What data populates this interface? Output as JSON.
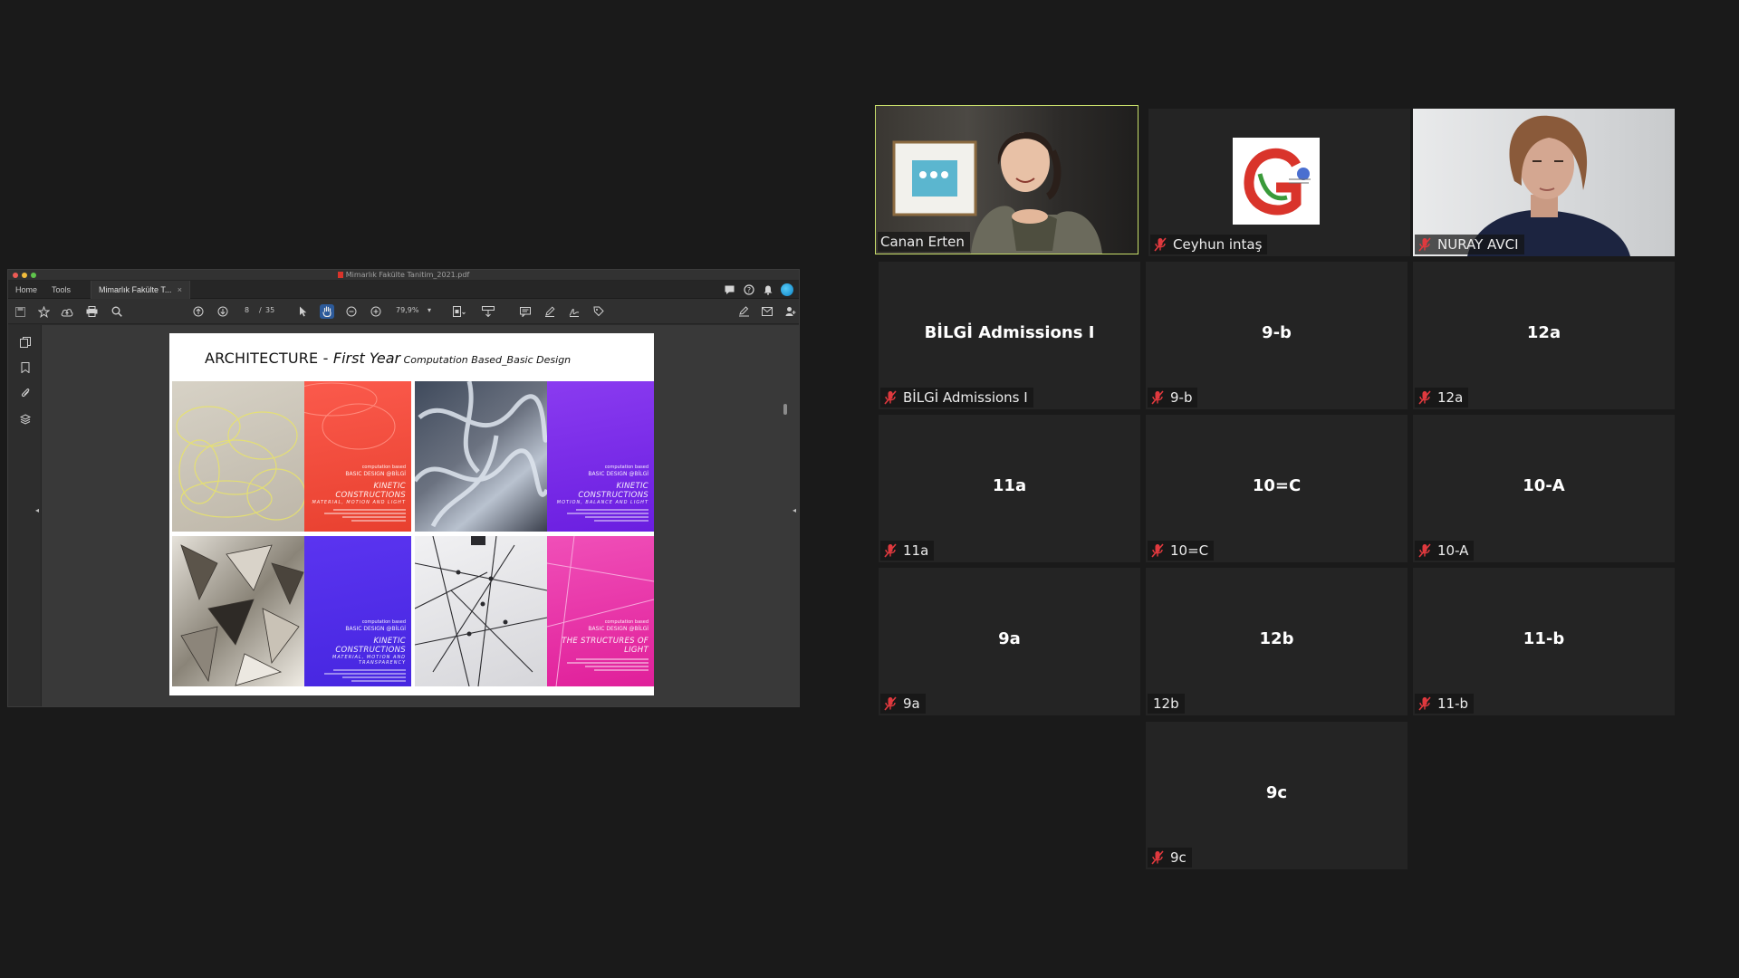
{
  "share": {
    "window_title": "Mimarlık Fakülte Tanitim_2021.pdf",
    "tabs": [
      {
        "label": "Home"
      },
      {
        "label": "Tools"
      },
      {
        "label": "Mimarlık Fakülte T..."
      }
    ],
    "tab_close": "×",
    "page_current": "8",
    "page_separator": "/",
    "page_total": "35",
    "zoom": "79,9%",
    "slide": {
      "title_part1": "ARCHITECTURE",
      "title_dash": " - ",
      "title_part2": "First Year",
      "title_part3": " Computation Based_Basic Design",
      "posters": [
        {
          "top_small": "computation based",
          "heading": "BASIC DESIGN @BİLGİ",
          "title": "KINETIC CONSTRUCTIONS",
          "subtitle": "MATERIAL, MOTION AND LIGHT"
        },
        {
          "top_small": "computation based",
          "heading": "BASIC DESIGN @BİLGİ",
          "title": "KINETIC CONSTRUCTIONS",
          "subtitle": "MOTION, BALANCE AND LIGHT"
        },
        {
          "top_small": "computation based",
          "heading": "BASIC DESIGN @BİLGİ",
          "title": "KINETIC CONSTRUCTIONS",
          "subtitle": "MATERIAL, MOTION AND TRANSPARENCY"
        },
        {
          "top_small": "computation based",
          "heading": "BASIC DESIGN @BİLGİ",
          "title": "THE STRUCTURES OF LIGHT",
          "subtitle": ""
        }
      ]
    }
  },
  "participants": [
    {
      "name": "Canan Erten",
      "kind": "video",
      "muted": false,
      "speaking": true
    },
    {
      "name": "Ceyhun intaş",
      "kind": "logo",
      "muted": true
    },
    {
      "name": "NURAY AVCI",
      "kind": "video",
      "muted": true
    },
    {
      "name": "BİLGİ Admissions I",
      "center": "BİLGİ Admissions I",
      "muted": true
    },
    {
      "name": "9-b",
      "center": "9-b",
      "muted": true
    },
    {
      "name": "12a",
      "center": "12a",
      "muted": true
    },
    {
      "name": "11a",
      "center": "11a",
      "muted": true
    },
    {
      "name": "10=C",
      "center": "10=C",
      "muted": true
    },
    {
      "name": "10-A",
      "center": "10-A",
      "muted": true
    },
    {
      "name": "9a",
      "center": "9a",
      "muted": true
    },
    {
      "name": "12b",
      "center": "12b",
      "muted": false
    },
    {
      "name": "11-b",
      "center": "11-b",
      "muted": true
    },
    {
      "name": "9c",
      "center": "9c",
      "muted": true
    }
  ],
  "colors": {
    "background": "#1a1a1a",
    "tile": "#242424",
    "active_speaker_border": "#c8df6b",
    "muted_icon": "#e0393e"
  },
  "icons": {
    "muted": "mic-muted-icon",
    "pdf": "pdf-file-icon"
  }
}
